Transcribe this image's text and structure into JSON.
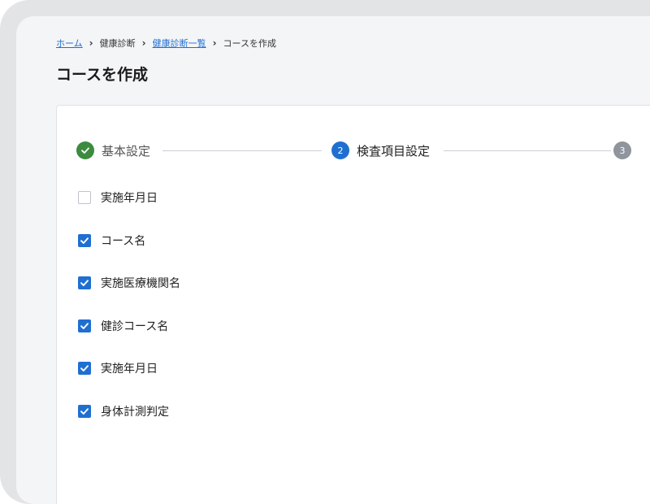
{
  "breadcrumb": {
    "home": "ホーム",
    "health_checkup": "健康診断",
    "checkup_list": "健康診断一覧",
    "current": "コースを作成"
  },
  "page": {
    "title": "コースを作成"
  },
  "stepper": {
    "steps": [
      {
        "number": "1",
        "label": "基本設定",
        "state": "done"
      },
      {
        "number": "2",
        "label": "検査項目設定",
        "state": "active"
      },
      {
        "number": "3",
        "label": "",
        "state": "pending"
      }
    ]
  },
  "items": [
    {
      "label": "実施年月日",
      "checked": false
    },
    {
      "label": "コース名",
      "checked": true
    },
    {
      "label": "実施医療機関名",
      "checked": true
    },
    {
      "label": "健診コース名",
      "checked": true
    },
    {
      "label": "実施年月日",
      "checked": true
    },
    {
      "label": "身体計測判定",
      "checked": true
    }
  ],
  "colors": {
    "accent": "#1f6fd1",
    "done": "#3c8b3f",
    "pending": "#8e959c"
  }
}
